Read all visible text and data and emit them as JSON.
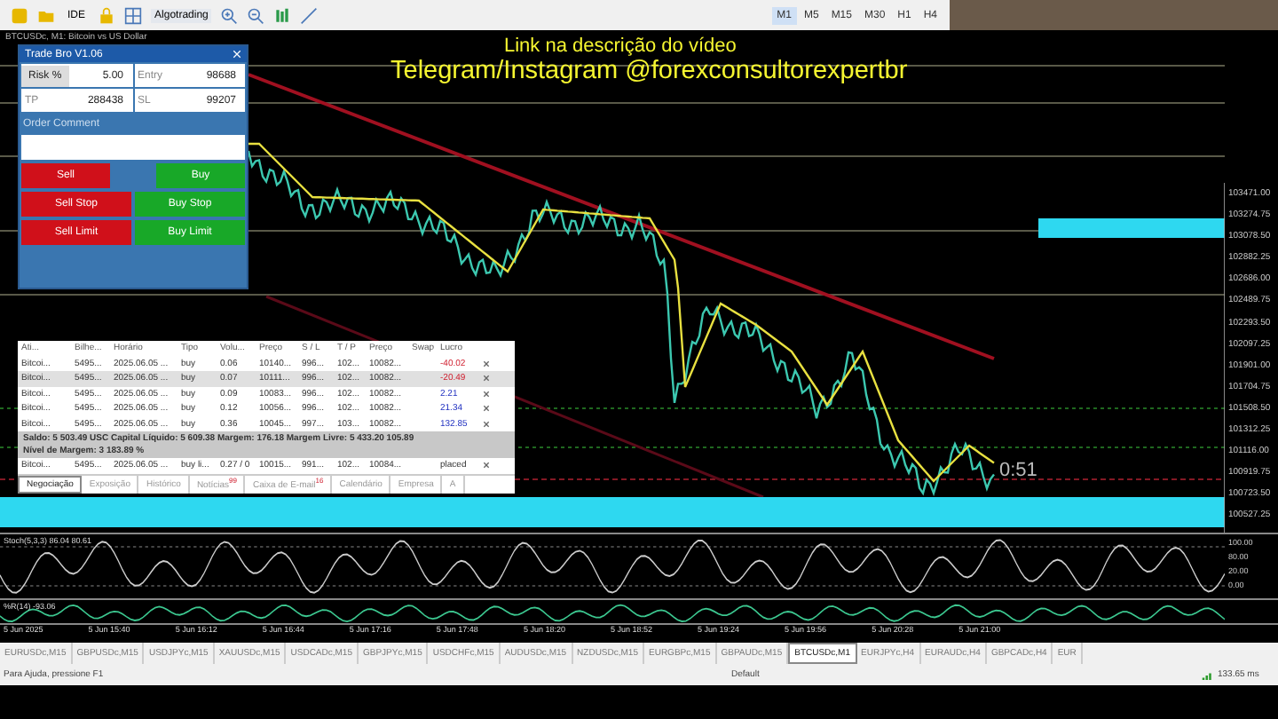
{
  "toolbar": {
    "buttons": [
      {
        "label": "IDE"
      },
      {
        "label": "Algotrading"
      }
    ],
    "timeframes": [
      {
        "label": "M1",
        "selected": true
      },
      {
        "label": "M5",
        "selected": false
      },
      {
        "label": "M15",
        "selected": false
      },
      {
        "label": "M30",
        "selected": false
      },
      {
        "label": "H1",
        "selected": false
      },
      {
        "label": "H4",
        "selected": false
      }
    ]
  },
  "chart": {
    "caption": "BTCUSDc, M1: Bitcoin vs US Dollar",
    "overlay_lines": [
      "Link na descrição do vídeo",
      "Telegram/Instagram @forexconsultorexpertbr"
    ],
    "price_labels": [
      "103471.00",
      "103274.75",
      "103078.50",
      "102882.25",
      "102686.00",
      "102489.75",
      "102293.50",
      "102097.25",
      "101901.00",
      "101704.75",
      "101508.50",
      "101312.25",
      "101116.00",
      "100919.75",
      "100723.50",
      "100527.25"
    ],
    "countdown": "0:51"
  },
  "trade_panel": {
    "title": "Trade Bro V1.06",
    "fields": [
      {
        "label": "Risk %",
        "value": "5.00"
      },
      {
        "label": "Entry",
        "value": "98688"
      },
      {
        "label": "TP",
        "value": "288438"
      },
      {
        "label": "SL",
        "value": "99207"
      }
    ],
    "comment_label": "Order Comment",
    "buttons": [
      {
        "label": "Sell",
        "kind": "sell"
      },
      {
        "label": "Buy",
        "kind": "buy"
      },
      {
        "label": "Sell Stop",
        "kind": "sell"
      },
      {
        "label": "Buy Stop",
        "kind": "buy"
      },
      {
        "label": "Sell Limit",
        "kind": "sell"
      },
      {
        "label": "Buy Limit",
        "kind": "buy"
      }
    ]
  },
  "terminal": {
    "columns": [
      "Ati...",
      "Bilhe...",
      "Horário",
      "Tipo",
      "Volu...",
      "Preço",
      "S / L",
      "T / P",
      "Preço",
      "Swap",
      "Lucro"
    ],
    "rows": [
      {
        "cells": [
          "Bitcoi...",
          "5495...",
          "2025.06.05 ...",
          "buy",
          "0.06",
          "10140...",
          "996...",
          "102...",
          "10082...",
          "",
          "-40.02"
        ],
        "kind": "loss",
        "selected": false
      },
      {
        "cells": [
          "Bitcoi...",
          "5495...",
          "2025.06.05 ...",
          "buy",
          "0.07",
          "10111...",
          "996...",
          "102...",
          "10082...",
          "",
          "-20.49"
        ],
        "kind": "loss",
        "selected": true
      },
      {
        "cells": [
          "Bitcoi...",
          "5495...",
          "2025.06.05 ...",
          "buy",
          "0.09",
          "10083...",
          "996...",
          "102...",
          "10082...",
          "",
          "2.21"
        ],
        "kind": "profit",
        "selected": false
      },
      {
        "cells": [
          "Bitcoi...",
          "5495...",
          "2025.06.05 ...",
          "buy",
          "0.12",
          "10056...",
          "996...",
          "102...",
          "10082...",
          "",
          "21.34"
        ],
        "kind": "profit",
        "selected": false
      },
      {
        "cells": [
          "Bitcoi...",
          "5495...",
          "2025.06.05 ...",
          "buy",
          "0.36",
          "10045...",
          "997...",
          "103...",
          "10082...",
          "",
          "132.85"
        ],
        "kind": "profit",
        "selected": false
      }
    ],
    "summary": "Saldo: 5 503.49 USC  Capital Líquido: 5 609.38  Margem: 176.18  Margem Livre: 5 433.20  105.89",
    "margin_level": "Nível de Margem: 3 183.89 %",
    "pending": {
      "cells": [
        "Bitcoi...",
        "5495...",
        "2025.06.05 ...",
        "buy li...",
        "0.27 / 0",
        "10015...",
        "991...",
        "102...",
        "10084...",
        "",
        "placed"
      ]
    },
    "tabs": [
      {
        "label": "Negociação",
        "selected": true
      },
      {
        "label": "Exposição",
        "selected": false
      },
      {
        "label": "Histórico",
        "selected": false
      },
      {
        "label": "Notícias",
        "badge": "99",
        "selected": false
      },
      {
        "label": "Caixa de E-mail",
        "badge": "16",
        "selected": false
      },
      {
        "label": "Calendário",
        "selected": false
      },
      {
        "label": "Empresa",
        "selected": false
      },
      {
        "label": "A",
        "selected": false
      }
    ]
  },
  "indicators": [
    {
      "caption": "Stoch(5,3,3) 86.04 80.61",
      "levels": [
        "100.00",
        "80.00",
        "20.00",
        "0.00"
      ]
    },
    {
      "caption": "%R(14) -93.06"
    }
  ],
  "time_axis": [
    "5 Jun 2025",
    "5 Jun 15:40",
    "5 Jun 16:12",
    "5 Jun 16:44",
    "5 Jun 17:16",
    "5 Jun 17:48",
    "5 Jun 18:20",
    "5 Jun 18:52",
    "5 Jun 19:24",
    "5 Jun 19:56",
    "5 Jun 20:28",
    "5 Jun 21:00"
  ],
  "symbol_tabs": [
    {
      "label": "EURUSDc,M15",
      "selected": false
    },
    {
      "label": "GBPUSDc,M15",
      "selected": false
    },
    {
      "label": "USDJPYc,M15",
      "selected": false
    },
    {
      "label": "XAUUSDc,M15",
      "selected": false
    },
    {
      "label": "USDCADc,M15",
      "selected": false
    },
    {
      "label": "GBPJPYc,M15",
      "selected": false
    },
    {
      "label": "USDCHFc,M15",
      "selected": false
    },
    {
      "label": "AUDUSDc,M15",
      "selected": false
    },
    {
      "label": "NZDUSDc,M15",
      "selected": false
    },
    {
      "label": "EURGBPc,M15",
      "selected": false
    },
    {
      "label": "GBPAUDc,M15",
      "selected": false
    },
    {
      "label": "BTCUSDc,M1",
      "selected": true
    },
    {
      "label": "EURJPYc,H4",
      "selected": false
    },
    {
      "label": "EURAUDc,H4",
      "selected": false
    },
    {
      "label": "GBPCADc,H4",
      "selected": false
    },
    {
      "label": "EUR",
      "selected": false
    }
  ],
  "status_bar": {
    "help": "Para Ajuda, pressione F1",
    "profile": "Default",
    "ping": "133.65 ms"
  }
}
